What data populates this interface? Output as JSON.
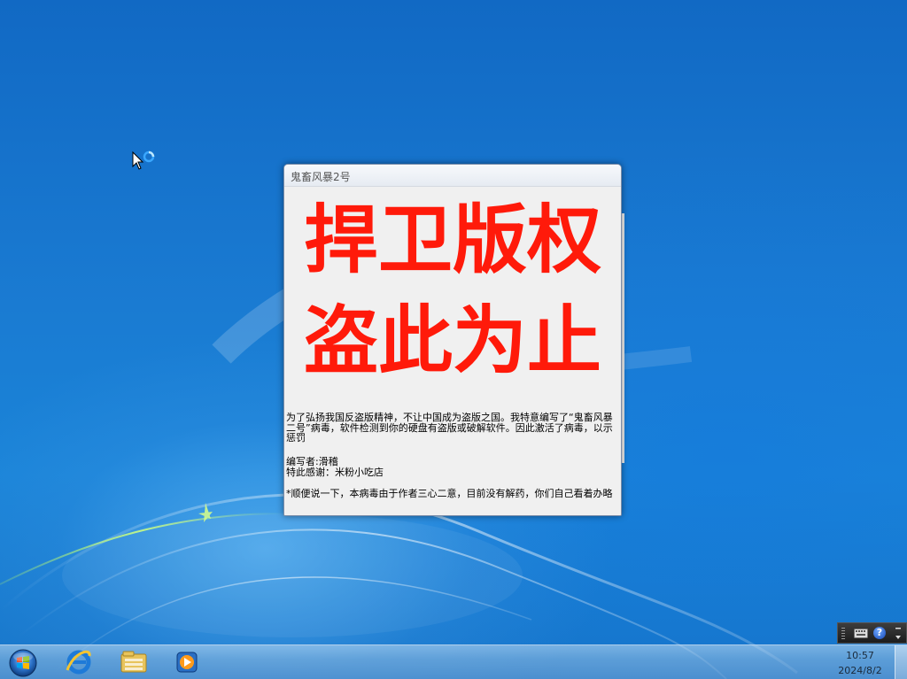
{
  "window": {
    "title": "鬼畜风暴2号",
    "slogan_line1": "捍卫版权",
    "slogan_line2": "盗此为止",
    "message_intro": "为了弘扬我国反盗版精神，不让中国成为盗版之国。我特意编写了“鬼畜风暴二号”病毒，软件检测到你的硬盘有盗版或破解软件。因此激活了病毒，以示惩罚",
    "author_line": "编写者:滑稽",
    "thanks_line": "特此感谢：米粉小吃店",
    "note_line": "*顺便说一下，本病毒由于作者三心二意，目前没有解药，你们自己看着办略",
    "slogan_color": "#ff1a0a"
  },
  "taskbar": {
    "start_icon": "windows-orb-icon",
    "pinned": [
      "internet-explorer-icon",
      "windows-explorer-icon",
      "media-player-icon"
    ],
    "clock_time": "10:57",
    "clock_date": "2024/8/2"
  },
  "language_bar": {
    "help_label": "?",
    "icons": [
      "keyboard-icon",
      "help-icon",
      "options-icon"
    ]
  },
  "colors": {
    "desktop_blue": "#1a7bd2",
    "slogan_red": "#ff1a0a"
  }
}
